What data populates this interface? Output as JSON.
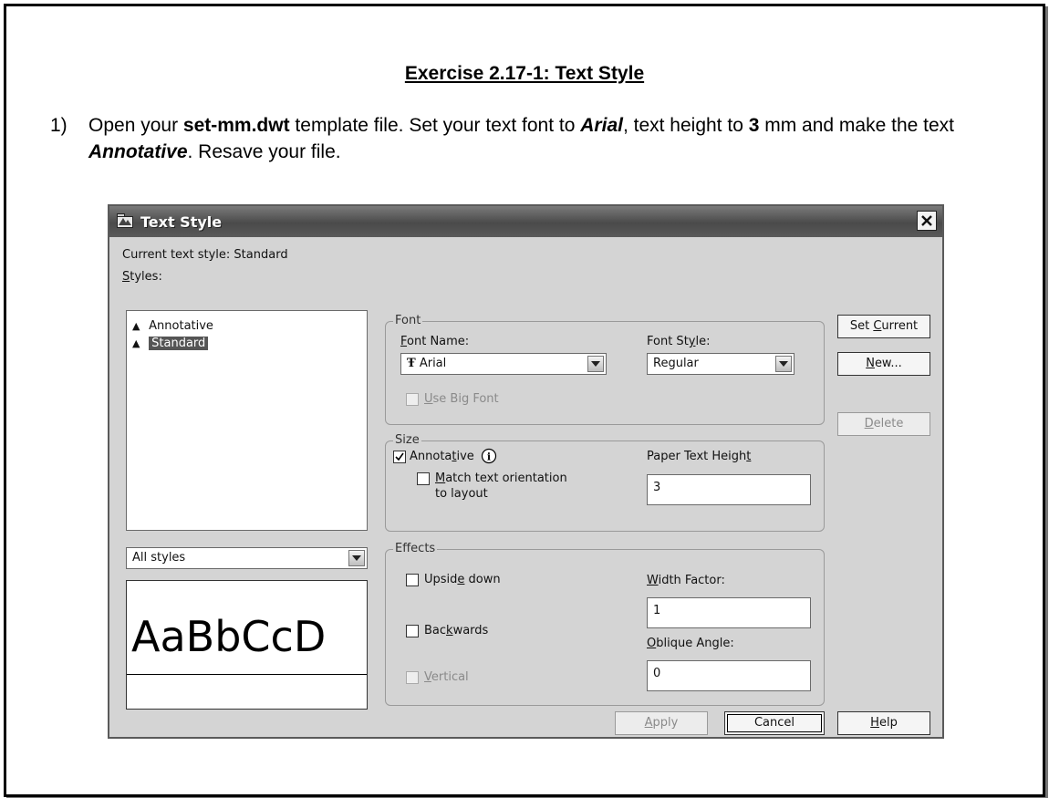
{
  "exercise": {
    "title": "Exercise 2.17-1:  Text Style",
    "step_number": "1)",
    "instruction_parts": [
      "Open your ",
      "set-mm.dwt",
      " template file.  Set your text font to ",
      "Arial",
      ", text height to ",
      "3",
      " mm and make the text ",
      "Annotative",
      ".  Resave your file."
    ]
  },
  "dialog": {
    "title": "Text Style",
    "current_style_label": "Current text style:  Standard",
    "styles_label": "Styles:",
    "styles": [
      {
        "name": "Annotative",
        "selected": false
      },
      {
        "name": "Standard",
        "selected": true
      }
    ],
    "styles_filter": "All styles",
    "preview_text": "AaBbCcD",
    "font": {
      "group_label": "Font",
      "font_name_label": "Font Name:",
      "font_name_value": "Arial",
      "font_style_label": "Font Style:",
      "font_style_value": "Regular",
      "use_big_font_label": "Use Big Font",
      "use_big_font_checked": false
    },
    "size": {
      "group_label": "Size",
      "annotative_label": "Annotative",
      "annotative_checked": true,
      "match_orientation_label_1": "Match text orientation",
      "match_orientation_label_2": "to layout",
      "match_orientation_checked": false,
      "paper_height_label": "Paper Text Height",
      "paper_height_value": "3"
    },
    "effects": {
      "group_label": "Effects",
      "upside_down_label": "Upside down",
      "backwards_label": "Backwards",
      "vertical_label": "Vertical",
      "width_factor_label": "Width Factor:",
      "width_factor_value": "1",
      "oblique_angle_label": "Oblique Angle:",
      "oblique_angle_value": "0"
    },
    "buttons": {
      "set_current": "Set Current",
      "new": "New...",
      "delete": "Delete",
      "apply": "Apply",
      "cancel": "Cancel",
      "help": "Help"
    }
  }
}
